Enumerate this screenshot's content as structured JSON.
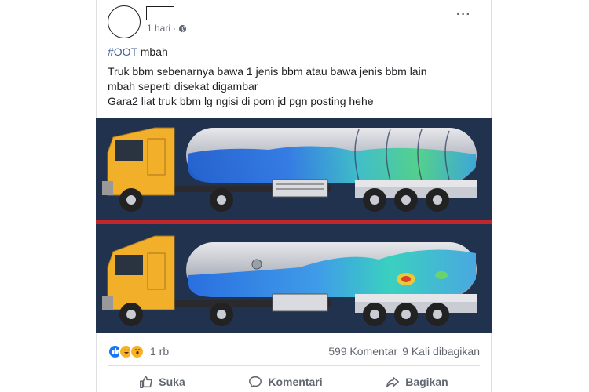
{
  "post": {
    "time": "1 hari",
    "more_icon": "ellipsis-icon",
    "hashtag": "#OOT",
    "hashtag_rest": " mbah",
    "lines": [
      "Truk bbm sebenarnya bawa 1 jenis bbm atau bawa jenis bbm lain",
      "mbah seperti disekat digambar",
      "Gara2 liat truk bbm lg ngisi di pom jd pgn posting hehe"
    ]
  },
  "media": {
    "description_icon": "tanker-truck-simulation-image",
    "colors": {
      "background": "#21324f",
      "cab": "#f2b02a",
      "divider": "#c0262b",
      "liquid": "#2f79d6"
    }
  },
  "stats": {
    "reactions": [
      "like-icon",
      "haha-icon",
      "wow-icon"
    ],
    "reaction_count": "1 rb",
    "comments": "599 Komentar",
    "shares": "9 Kali dibagikan"
  },
  "actions": {
    "like": "Suka",
    "comment": "Komentari",
    "share": "Bagikan"
  }
}
